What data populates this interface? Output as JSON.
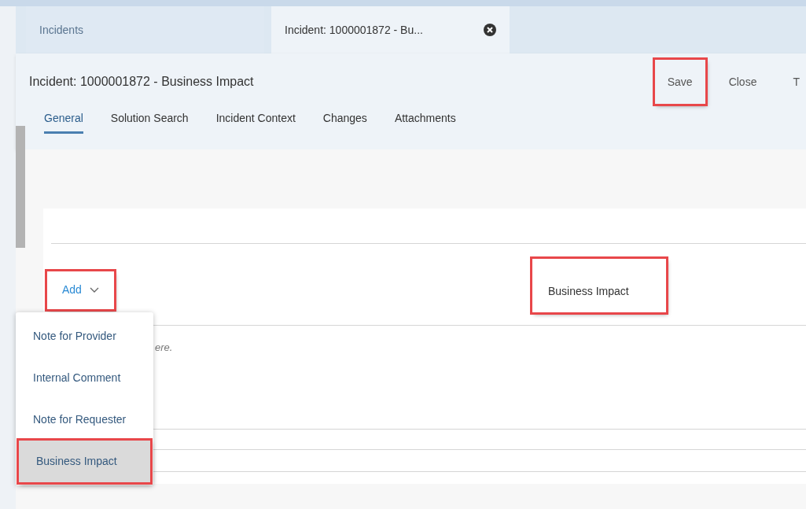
{
  "tabs": [
    {
      "label": "Incidents",
      "selected": false,
      "closable": false
    },
    {
      "label": "Incident: 1000001872 - Bu...",
      "selected": true,
      "closable": true
    }
  ],
  "header": {
    "title": "Incident: 1000001872 - Business Impact",
    "actions": [
      {
        "label": "Save",
        "highlighted": true
      },
      {
        "label": "Close",
        "highlighted": false
      },
      {
        "label": "T",
        "highlighted": false
      }
    ],
    "sections": [
      {
        "label": "General",
        "selected": true
      },
      {
        "label": "Solution Search",
        "selected": false
      },
      {
        "label": "Incident Context",
        "selected": false
      },
      {
        "label": "Changes",
        "selected": false
      },
      {
        "label": "Attachments",
        "selected": false
      }
    ]
  },
  "notes": {
    "add_button": {
      "label": "Add",
      "highlighted": true
    },
    "type_label": {
      "label": "Business Impact",
      "highlighted": true
    },
    "placeholder_fragment": "ere.",
    "menu": [
      {
        "label": "Note for Provider",
        "selected": false,
        "highlighted": false
      },
      {
        "label": "Internal Comment",
        "selected": false,
        "highlighted": false
      },
      {
        "label": "Note for Requester",
        "selected": false,
        "highlighted": false
      },
      {
        "label": "Business Impact",
        "selected": true,
        "highlighted": true
      }
    ]
  }
}
